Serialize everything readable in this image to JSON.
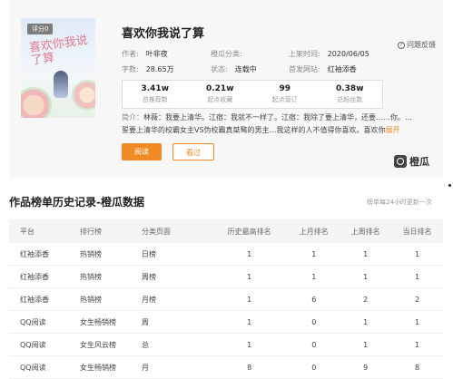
{
  "book": {
    "rating_badge": "评分0",
    "cover_title": "喜欢你我说了算",
    "title": "喜欢你我说了算",
    "feedback": "问题反馈",
    "meta": [
      {
        "label": "作者:",
        "value": "叶非夜"
      },
      {
        "label": "橙瓜分类:",
        "value": ""
      },
      {
        "label": "上架时间:",
        "value": "2020/06/05"
      },
      {
        "label": "字数:",
        "value": "28.65万"
      },
      {
        "label": "状态:",
        "value": "连载中"
      },
      {
        "label": "首发网站:",
        "value": "红袖添香"
      }
    ],
    "stats": [
      {
        "num": "3.41w",
        "label": "总推荐数"
      },
      {
        "num": "0.21w",
        "label": "起点收藏"
      },
      {
        "num": "99",
        "label": "起点营订"
      },
      {
        "num": "0.38w",
        "label": "总粉丝数"
      }
    ],
    "intro_label": "简介：",
    "intro_line1": "林薇：我要上清华。江宿：我就不一样了。江宿：我除了要上清华，还要……你。…",
    "intro_line2": "誓要上清华的校霸女主VS伪校霸真桀骜的男主…我这样的人不值得你喜欢。喜欢你",
    "intro_more": "展开",
    "btn_read": "阅读",
    "btn_subscribe": "看过",
    "brand": "橙瓜"
  },
  "ranking": {
    "title": "作品榜单历史记录-橙瓜数据",
    "note": "榜单每24小时更新一次",
    "columns": [
      "平台",
      "排行榜",
      "分类页面",
      "历史最高排名",
      "上月排名",
      "上周排名",
      "当日排名"
    ],
    "rows": [
      [
        "红袖添香",
        "热销榜",
        "日榜",
        "1",
        "1",
        "1",
        "1"
      ],
      [
        "红袖添香",
        "热销榜",
        "周榜",
        "1",
        "1",
        "1",
        "1"
      ],
      [
        "红袖添香",
        "热销榜",
        "月榜",
        "1",
        "6",
        "2",
        "2"
      ],
      [
        "QQ阅读",
        "女生畅销榜",
        "周",
        "1",
        "0",
        "1",
        "1"
      ],
      [
        "QQ阅读",
        "女生风云榜",
        "总",
        "1",
        "0",
        "1",
        "1"
      ],
      [
        "QQ阅读",
        "女生畅销榜",
        "月",
        "8",
        "0",
        "9",
        "8"
      ]
    ]
  },
  "colors": {
    "accent": "#f08a24"
  }
}
